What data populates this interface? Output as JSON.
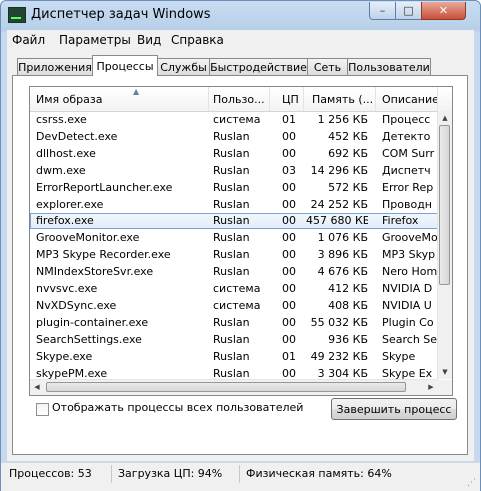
{
  "window": {
    "title": "Диспетчер задач Windows",
    "controls": {
      "minimize": "–",
      "maximize": "□",
      "close": "✕"
    }
  },
  "menu": [
    "Файл",
    "Параметры",
    "Вид",
    "Справка"
  ],
  "tabs": [
    "Приложения",
    "Процессы",
    "Службы",
    "Быстродействие",
    "Сеть",
    "Пользователи"
  ],
  "active_tab": "Процессы",
  "columns": [
    "Имя образа",
    "Пользо...",
    "ЦП",
    "Память (...",
    "Описание"
  ],
  "processes": [
    {
      "name": "csrss.exe",
      "user": "система",
      "cpu": "01",
      "memory": "1 256 КБ",
      "desc": "Процесс"
    },
    {
      "name": "DevDetect.exe",
      "user": "Ruslan",
      "cpu": "00",
      "memory": "452 КБ",
      "desc": "Детекто"
    },
    {
      "name": "dllhost.exe",
      "user": "Ruslan",
      "cpu": "00",
      "memory": "692 КБ",
      "desc": "COM Surr"
    },
    {
      "name": "dwm.exe",
      "user": "Ruslan",
      "cpu": "03",
      "memory": "14 296 КБ",
      "desc": "Диспетч"
    },
    {
      "name": "ErrorReportLauncher.exe",
      "user": "Ruslan",
      "cpu": "00",
      "memory": "572 КБ",
      "desc": "Error Rep"
    },
    {
      "name": "explorer.exe",
      "user": "Ruslan",
      "cpu": "00",
      "memory": "24 252 КБ",
      "desc": "Проводн"
    },
    {
      "name": "firefox.exe",
      "user": "Ruslan",
      "cpu": "00",
      "memory": "457 680 КБ",
      "desc": "Firefox"
    },
    {
      "name": "GrooveMonitor.exe",
      "user": "Ruslan",
      "cpu": "00",
      "memory": "1 076 КБ",
      "desc": "GrooveMo"
    },
    {
      "name": "MP3 Skype Recorder.exe",
      "user": "Ruslan",
      "cpu": "00",
      "memory": "3 896 КБ",
      "desc": "MP3 Skyp"
    },
    {
      "name": "NMIndexStoreSvr.exe",
      "user": "Ruslan",
      "cpu": "00",
      "memory": "4 676 КБ",
      "desc": "Nero Hom"
    },
    {
      "name": "nvvsvc.exe",
      "user": "система",
      "cpu": "00",
      "memory": "412 КБ",
      "desc": "NVIDIA D"
    },
    {
      "name": "NvXDSync.exe",
      "user": "система",
      "cpu": "00",
      "memory": "408 КБ",
      "desc": "NVIDIA U"
    },
    {
      "name": "plugin-container.exe",
      "user": "Ruslan",
      "cpu": "00",
      "memory": "55 032 КБ",
      "desc": "Plugin Co"
    },
    {
      "name": "SearchSettings.exe",
      "user": "Ruslan",
      "cpu": "00",
      "memory": "936 КБ",
      "desc": "Search Se"
    },
    {
      "name": "Skype.exe",
      "user": "Ruslan",
      "cpu": "01",
      "memory": "49 232 КБ",
      "desc": "Skype"
    },
    {
      "name": "skypePM.exe",
      "user": "Ruslan",
      "cpu": "00",
      "memory": "3 304 КБ",
      "desc": "Skype Ex"
    }
  ],
  "selected_process": "firefox.exe",
  "show_all_label": "Отображать процессы всех пользователей",
  "end_process_label": "Завершить процесс",
  "status": {
    "processes": "Процессов: 53",
    "cpu": "Загрузка ЦП: 94%",
    "memory": "Физическая память: 64%"
  }
}
